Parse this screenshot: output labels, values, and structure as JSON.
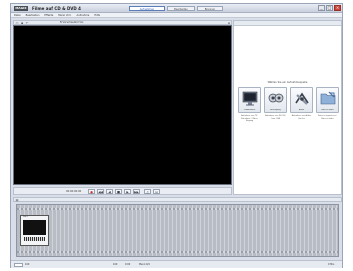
{
  "app": {
    "logo": "MAGIX",
    "title": "Filme auf CD & DVD 4"
  },
  "mode_tabs": [
    {
      "label": "Aufnehmen",
      "active": true
    },
    {
      "label": "Bearbeiten",
      "active": false
    },
    {
      "label": "Brennen",
      "active": false
    }
  ],
  "window_buttons": {
    "minimize": "_",
    "maximize": "□",
    "close": "×"
  },
  "menubar": [
    "Datei",
    "Bearbeiten",
    "Effekte",
    "Menü Vorl.",
    "Aufnahme",
    "Hilfe"
  ],
  "preview": {
    "label": "B Vorschaubild Vor."
  },
  "transport": {
    "timecode": "00:00:00:00",
    "buttons": [
      "●",
      "◀◀",
      "◀",
      "■",
      "▶",
      "▶▶",
      "♫",
      "⊡"
    ]
  },
  "menu_panel": {
    "heading": "Wählen Sie ein Aufnahmequelle",
    "buttons": [
      {
        "caption": "TV-Aufnahme",
        "icon": "tv-icon",
        "desc": "Aufnahme von TV, Videokarte / Video-Eingang"
      },
      {
        "caption": "AV-Eingang",
        "icon": "camera-icon",
        "desc": "Aufnahme von DV, DV-Cam, USB"
      },
      {
        "caption": "Audio",
        "icon": "audio-icon",
        "desc": "Aufnahme von Audio-Quellen"
      },
      {
        "caption": "Dateien laden",
        "icon": "folder-icon",
        "desc": "Dateien importieren / Dateien laden"
      }
    ]
  },
  "storyboard": {
    "clip_title": "Film 1"
  },
  "statusbar": {
    "left": "100",
    "center_a": "100",
    "center_b": "0:00",
    "center_c": "Menü 0/4",
    "right": "0 Min."
  },
  "colors": {
    "accent": "#2a59b8",
    "preview_bg": "#000000",
    "record": "#c72a22"
  }
}
